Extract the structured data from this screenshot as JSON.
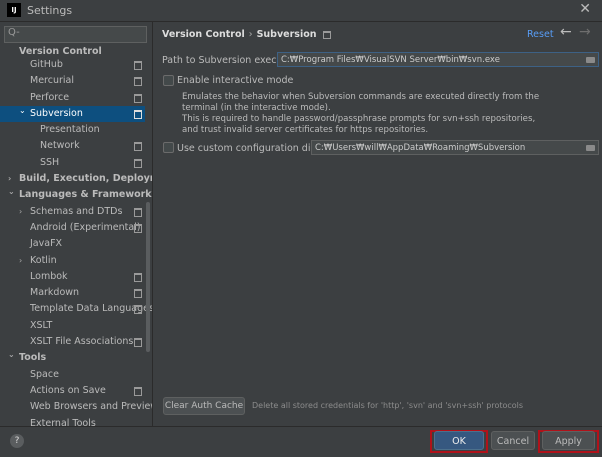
{
  "window": {
    "title": "Settings",
    "app_icon_label": "IJ"
  },
  "sidebar": {
    "search": {
      "placeholder": "Q-"
    },
    "group_label": "Version Control",
    "items": [
      {
        "label": "GitHub",
        "indent": 1,
        "arrow": "",
        "project": true
      },
      {
        "label": "Mercurial",
        "indent": 1,
        "arrow": "",
        "project": true
      },
      {
        "label": "Perforce",
        "indent": 1,
        "arrow": "",
        "project": true
      },
      {
        "label": "Subversion",
        "indent": 1,
        "arrow": "v",
        "project": true,
        "selected": true
      },
      {
        "label": "Presentation",
        "indent": 2,
        "arrow": "",
        "project": false
      },
      {
        "label": "Network",
        "indent": 2,
        "arrow": "",
        "project": true
      },
      {
        "label": "SSH",
        "indent": 2,
        "arrow": "",
        "project": true
      },
      {
        "label": "Build, Execution, Deployment",
        "indent": 0,
        "arrow": ">",
        "project": false,
        "bold": true
      },
      {
        "label": "Languages & Frameworks",
        "indent": 0,
        "arrow": "v",
        "project": false,
        "bold": true
      },
      {
        "label": "Schemas and DTDs",
        "indent": 1,
        "arrow": ">",
        "project": true
      },
      {
        "label": "Android (Experimental)",
        "indent": 1,
        "arrow": "",
        "project": true
      },
      {
        "label": "JavaFX",
        "indent": 1,
        "arrow": "",
        "project": false
      },
      {
        "label": "Kotlin",
        "indent": 1,
        "arrow": ">",
        "project": false
      },
      {
        "label": "Lombok",
        "indent": 1,
        "arrow": "",
        "project": true
      },
      {
        "label": "Markdown",
        "indent": 1,
        "arrow": "",
        "project": true
      },
      {
        "label": "Template Data Languages",
        "indent": 1,
        "arrow": "",
        "project": true
      },
      {
        "label": "XSLT",
        "indent": 1,
        "arrow": "",
        "project": false
      },
      {
        "label": "XSLT File Associations",
        "indent": 1,
        "arrow": "",
        "project": true
      },
      {
        "label": "Tools",
        "indent": 0,
        "arrow": "v",
        "project": false,
        "bold": true
      },
      {
        "label": "Space",
        "indent": 1,
        "arrow": "",
        "project": false
      },
      {
        "label": "Actions on Save",
        "indent": 1,
        "arrow": "",
        "project": true
      },
      {
        "label": "Web Browsers and Preview",
        "indent": 1,
        "arrow": "",
        "project": false
      },
      {
        "label": "External Tools",
        "indent": 1,
        "arrow": "",
        "project": false
      }
    ]
  },
  "header": {
    "breadcrumb": [
      "Version Control",
      "Subversion"
    ],
    "reset_label": "Reset",
    "back_icon": "arrow-left-icon",
    "forward_icon": "arrow-right-icon"
  },
  "settings": {
    "path_label": "Path to Subversion executable:",
    "path_value": "C:₩Program Files₩VisualSVN Server₩bin₩svn.exe",
    "interactive_label": "Enable interactive mode",
    "interactive_desc": [
      "Emulates the behavior when Subversion commands are executed directly from the",
      "terminal (in the interactive mode).",
      "This is required to handle password/passphrase prompts for svn+ssh repositories,",
      "and trust invalid server certificates for https repositories."
    ],
    "custom_dir_label": "Use custom configuration directory:",
    "custom_dir_value": "C:₩Users₩will₩AppData₩Roaming₩Subversion",
    "clear_cache_label": "Clear Auth Cache",
    "clear_cache_desc": "Delete all stored credentials for 'http', 'svn' and 'svn+ssh' protocols"
  },
  "footer": {
    "help_label": "?",
    "ok_label": "OK",
    "cancel_label": "Cancel",
    "apply_label": "Apply"
  },
  "colors": {
    "accent": "#589df6",
    "selection": "#0d4f7f",
    "highlight_border": "#b0121a",
    "background": "#3c3f41"
  }
}
